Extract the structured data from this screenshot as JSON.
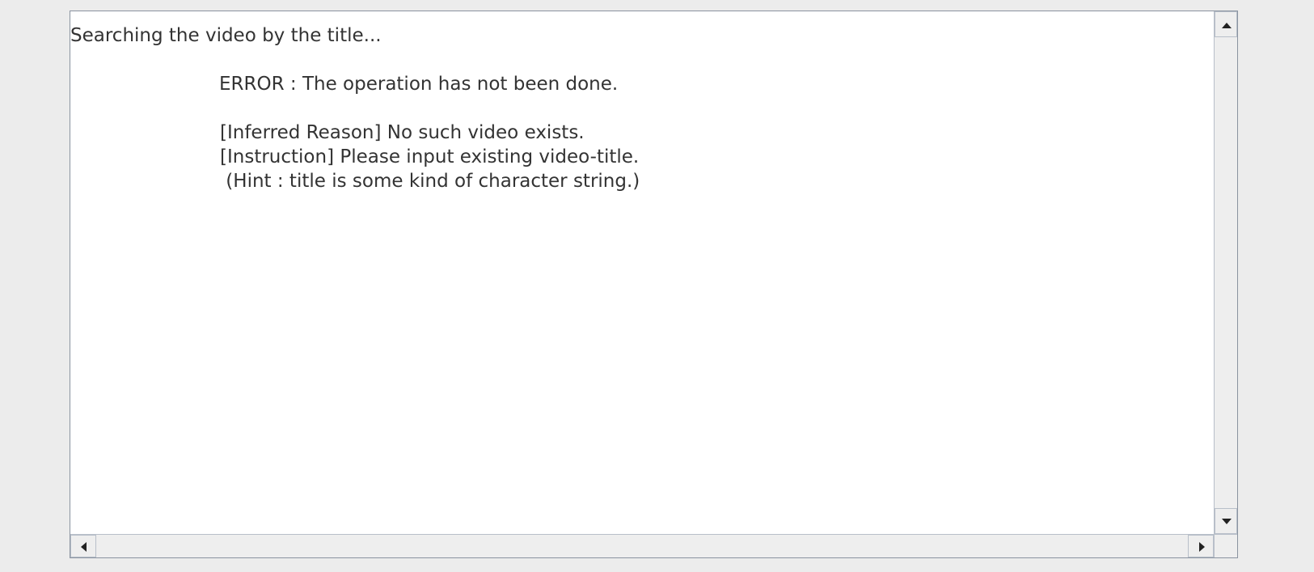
{
  "output_area": {
    "lines": [
      "Searching the video by the title...",
      "ERROR : The operation has not been done.",
      "[Inferred Reason] No such video exists.",
      "[Instruction] Please input existing video-title.",
      " (Hint : title is some kind of character string.)"
    ]
  },
  "scrollbars": {
    "vertical": {
      "up_icon": "triangle-up-icon",
      "down_icon": "triangle-down-icon"
    },
    "horizontal": {
      "left_icon": "triangle-left-icon",
      "right_icon": "triangle-right-icon"
    }
  },
  "colors": {
    "window_background": "#ececec",
    "text_area_background": "#ffffff",
    "text": "#333333",
    "border": "#8a93a0",
    "arrow": "#222222"
  }
}
